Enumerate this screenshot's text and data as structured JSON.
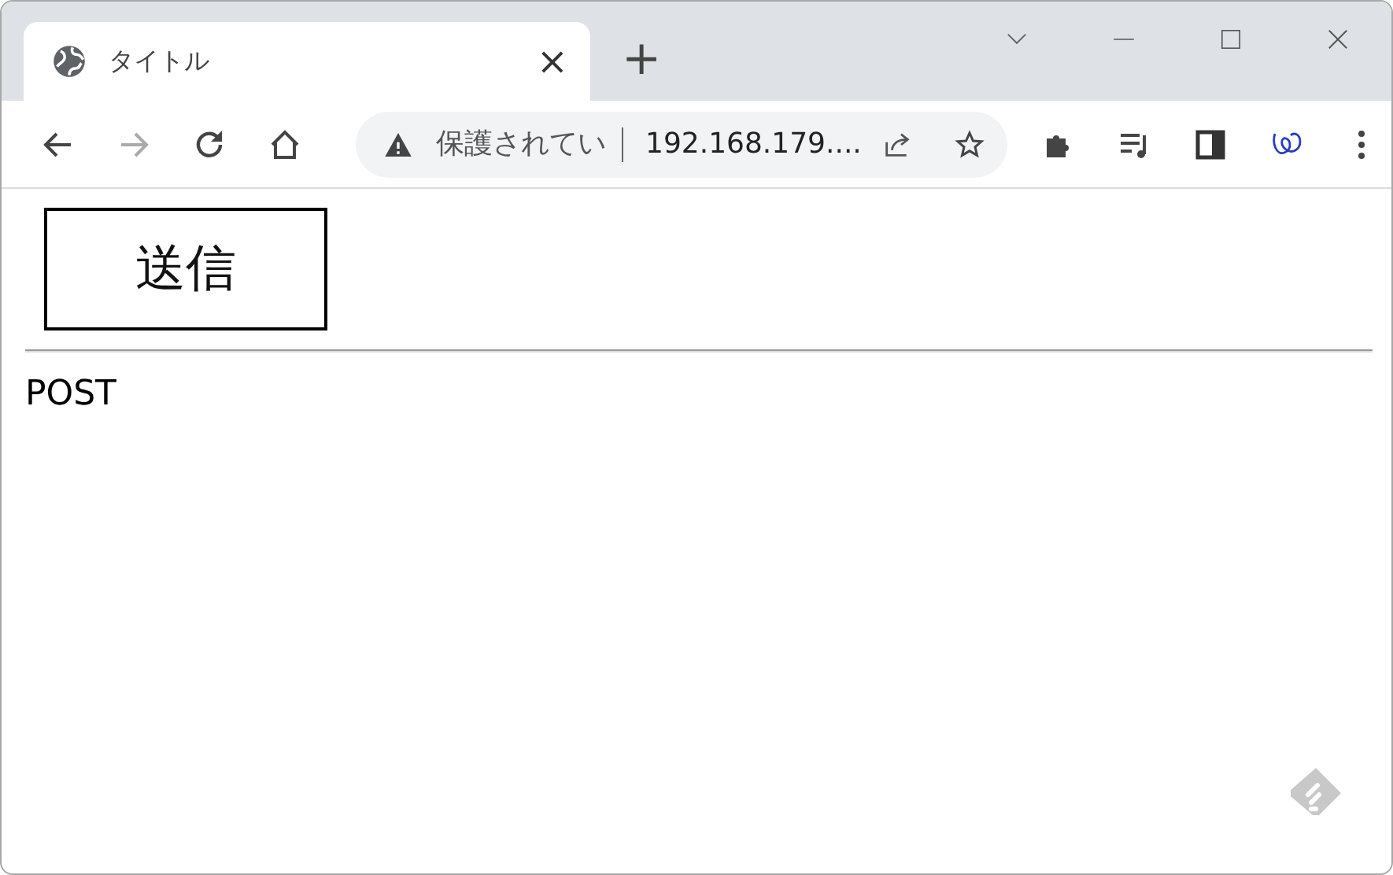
{
  "browser": {
    "tab": {
      "title": "タイトル",
      "close": "×"
    },
    "new_tab": "+",
    "address_bar": {
      "security_label": "保護されてい",
      "url": "192.168.179...."
    }
  },
  "page": {
    "submit_button": "送信",
    "output": "POST"
  }
}
